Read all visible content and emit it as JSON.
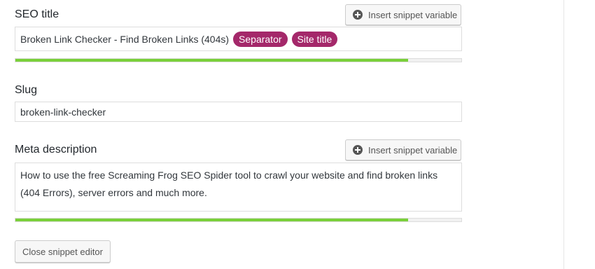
{
  "seo_title": {
    "label": "SEO title",
    "insert_button": "Insert snippet variable",
    "value_text": "Broken Link Checker - Find Broken Links (404s)",
    "variables": [
      "Separator",
      "Site title"
    ],
    "progress": 0.88
  },
  "slug": {
    "label": "Slug",
    "value": "broken-link-checker"
  },
  "meta_description": {
    "label": "Meta description",
    "insert_button": "Insert snippet variable",
    "value": "How to use the free Screaming Frog SEO Spider tool to crawl your website and find broken links (404 Errors), server errors and much more.",
    "progress": 0.88
  },
  "close_button": "Close snippet editor",
  "colors": {
    "variable_pill": "#a4286a",
    "progress_good": "#7ad03a"
  },
  "icons": {
    "insert_variable": "plus-circle-icon"
  }
}
